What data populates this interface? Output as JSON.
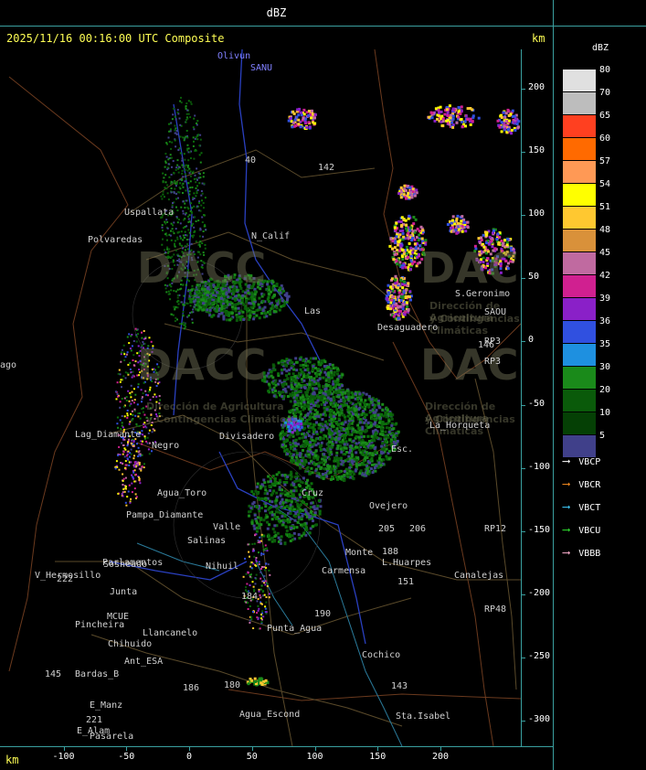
{
  "title": "dBZ",
  "header": "2025/11/16 00:16:00 UTC Composite",
  "units": {
    "top": "km",
    "bottom": "km"
  },
  "legend": {
    "title": "dBZ",
    "levels": [
      {
        "label": "80",
        "color": "#e0e0e0"
      },
      {
        "label": "70",
        "color": "#bdbdbd"
      },
      {
        "label": "65",
        "color": "#ff4020"
      },
      {
        "label": "60",
        "color": "#ff6a00"
      },
      {
        "label": "57",
        "color": "#ff9955"
      },
      {
        "label": "54",
        "color": "#ffff00"
      },
      {
        "label": "51",
        "color": "#ffc830"
      },
      {
        "label": "48",
        "color": "#d9913a"
      },
      {
        "label": "45",
        "color": "#c06aa0"
      },
      {
        "label": "42",
        "color": "#d02090"
      },
      {
        "label": "39",
        "color": "#8a20c8"
      },
      {
        "label": "36",
        "color": "#3050e0"
      },
      {
        "label": "35",
        "color": "#1e90e0"
      },
      {
        "label": "30",
        "color": "#1a8a1a"
      },
      {
        "label": "20",
        "color": "#0a5a0a"
      },
      {
        "label": "10",
        "color": "#054005"
      },
      {
        "label": "5",
        "color": "#40408a"
      }
    ],
    "sites": [
      {
        "label": "VBCP",
        "color": "#ffffff"
      },
      {
        "label": "VBCR",
        "color": "#ff9020"
      },
      {
        "label": "VBCT",
        "color": "#40d0ff"
      },
      {
        "label": "VBCU",
        "color": "#30e030"
      },
      {
        "label": "VBBB",
        "color": "#ffb0d0"
      }
    ]
  },
  "axes": {
    "x_ticks": [
      "-100",
      "-50",
      "0",
      "50",
      "100",
      "150",
      "200"
    ],
    "y_ticks": [
      "200",
      "150",
      "100",
      "50",
      "0",
      "-50",
      "-100",
      "-150",
      "-200",
      "-250",
      "-300"
    ]
  },
  "watermark": {
    "text": "DACC",
    "sub1": "Dirección de Agricultura",
    "sub2": "y Contingencias Climáticas"
  },
  "places": [
    {
      "name": "Olivun",
      "color": "#8080ff"
    },
    {
      "name": "SANU",
      "color": "#8080ff"
    },
    {
      "name": "Uspallata",
      "color": "#d0d0d0"
    },
    {
      "name": "Polvaredas",
      "color": "#d0d0d0"
    },
    {
      "name": "N_Calif",
      "color": "#d0d0d0"
    },
    {
      "name": "142",
      "color": "#d0d0d0"
    },
    {
      "name": "40",
      "color": "#d0d0d0"
    },
    {
      "name": "Las",
      "color": "#d0d0d0"
    },
    {
      "name": "Desaguadero",
      "color": "#d0d0d0"
    },
    {
      "name": "S.Geronimo",
      "color": "#d0d0d0"
    },
    {
      "name": "SAOU",
      "color": "#d0d0d0"
    },
    {
      "name": "RP3",
      "color": "#d0d0d0"
    },
    {
      "name": "146",
      "color": "#d0d0d0"
    },
    {
      "name": "La_Horqueta",
      "color": "#d0d0d0"
    },
    {
      "name": "Lag_Diamante",
      "color": "#d0d0d0"
    },
    {
      "name": "Divisadero",
      "color": "#d0d0d0"
    },
    {
      "name": "Negro",
      "color": "#d0d0d0"
    },
    {
      "name": "Agua_Toro",
      "color": "#d0d0d0"
    },
    {
      "name": "Pampa_Diamante",
      "color": "#d0d0d0"
    },
    {
      "name": "Salinas",
      "color": "#d0d0d0"
    },
    {
      "name": "Valle",
      "color": "#d0d0d0"
    },
    {
      "name": "Parlamentos",
      "color": "#d0d0d0"
    },
    {
      "name": "Sosneado",
      "color": "#d0d0d0"
    },
    {
      "name": "V_Hermosillo",
      "color": "#d0d0d0"
    },
    {
      "name": "Nihuil",
      "color": "#d0d0d0"
    },
    {
      "name": "Monte",
      "color": "#d0d0d0"
    },
    {
      "name": "Ovejero",
      "color": "#d0d0d0"
    },
    {
      "name": "205",
      "color": "#d0d0d0"
    },
    {
      "name": "206",
      "color": "#d0d0d0"
    },
    {
      "name": "RP12",
      "color": "#d0d0d0"
    },
    {
      "name": "L.Huarpes",
      "color": "#d0d0d0"
    },
    {
      "name": "188",
      "color": "#d0d0d0"
    },
    {
      "name": "Canalejas",
      "color": "#d0d0d0"
    },
    {
      "name": "Carmensa",
      "color": "#d0d0d0"
    },
    {
      "name": "151",
      "color": "#d0d0d0"
    },
    {
      "name": "RP48",
      "color": "#d0d0d0"
    },
    {
      "name": "Punta_Agua",
      "color": "#d0d0d0"
    },
    {
      "name": "Llancanelo",
      "color": "#d0d0d0"
    },
    {
      "name": "Pincheira",
      "color": "#d0d0d0"
    },
    {
      "name": "Chihuido",
      "color": "#d0d0d0"
    },
    {
      "name": "Ant_ESA",
      "color": "#d0d0d0"
    },
    {
      "name": "Bardas_B",
      "color": "#d0d0d0"
    },
    {
      "name": "Agua_Escond",
      "color": "#d0d0d0"
    },
    {
      "name": "Cochico",
      "color": "#d0d0d0"
    },
    {
      "name": "143",
      "color": "#d0d0d0"
    },
    {
      "name": "Sta.Isabel",
      "color": "#d0d0d0"
    },
    {
      "name": "E_Manz",
      "color": "#d0d0d0"
    },
    {
      "name": "E_Alam",
      "color": "#d0d0d0"
    },
    {
      "name": "Pasarela",
      "color": "#d0d0d0"
    },
    {
      "name": "221",
      "color": "#d0d0d0"
    },
    {
      "name": "145",
      "color": "#d0d0d0"
    },
    {
      "name": "180",
      "color": "#d0d0d0"
    },
    {
      "name": "186",
      "color": "#d0d0d0"
    },
    {
      "name": "184",
      "color": "#d0d0d0"
    },
    {
      "name": "190",
      "color": "#d0d0d0"
    },
    {
      "name": "222",
      "color": "#d0d0d0"
    },
    {
      "name": "ago",
      "color": "#d0d0d0"
    },
    {
      "name": "Esc.",
      "color": "#d0d0d0"
    },
    {
      "name": "Cruz",
      "color": "#d0d0d0"
    },
    {
      "name": "Junta",
      "color": "#d0d0d0"
    },
    {
      "name": "MCUE",
      "color": "#d0d0d0"
    },
    {
      "name": "RP3",
      "color": "#d0d0d0"
    }
  ]
}
